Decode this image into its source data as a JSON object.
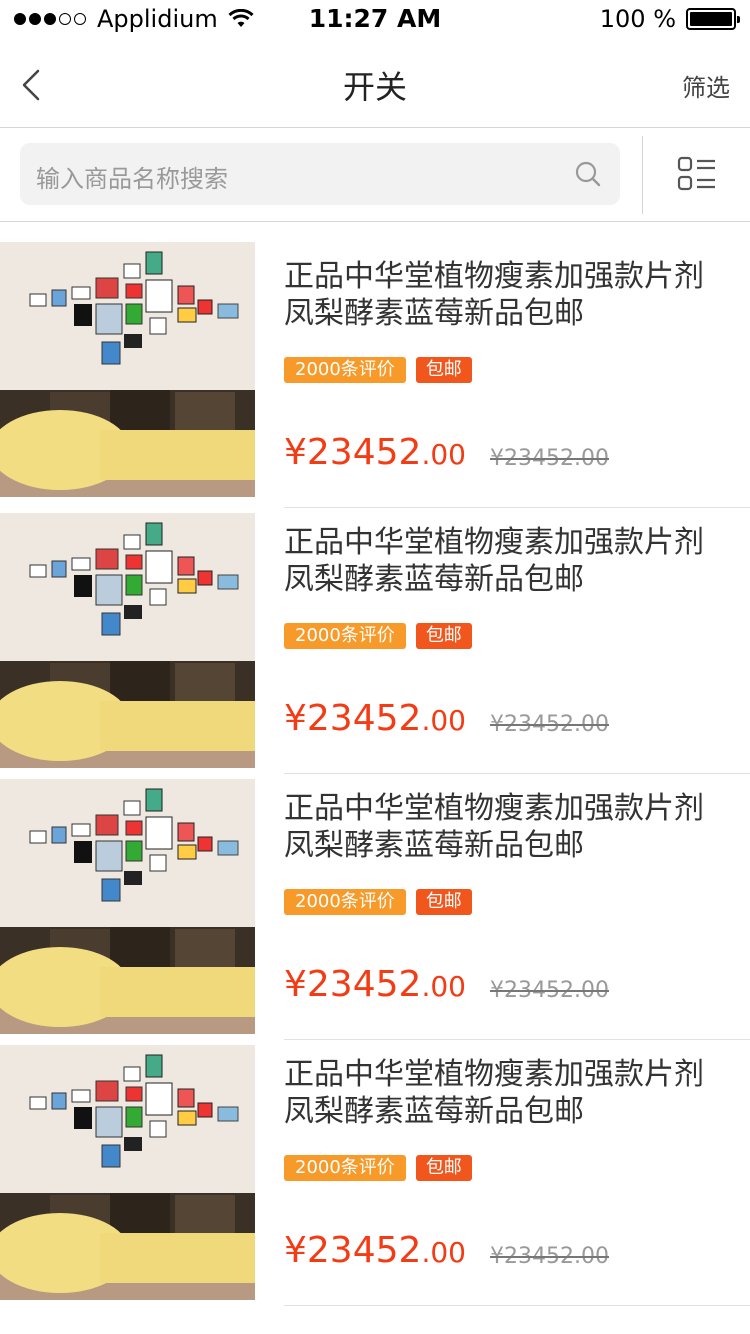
{
  "status_bar": {
    "carrier": "Applidium",
    "time": "11:27 AM",
    "battery": "100 %"
  },
  "nav": {
    "title": "开关",
    "filter": "筛选",
    "back_icon": "chevron-left-icon"
  },
  "search": {
    "placeholder": "输入商品名称搜索",
    "icon": "search-icon",
    "view_toggle_icon": "list-grid-toggle-icon"
  },
  "products": [
    {
      "title": "正品中华堂植物瘦素加强款片剂凤梨酵素蓝莓新品包邮",
      "reviews_tag": "2000条评价",
      "shipping_tag": "包邮",
      "price_main": "¥23452",
      "price_decimals": ".00",
      "old_price": "¥23452.00"
    },
    {
      "title": "正品中华堂植物瘦素加强款片剂凤梨酵素蓝莓新品包邮",
      "reviews_tag": "2000条评价",
      "shipping_tag": "包邮",
      "price_main": "¥23452",
      "price_decimals": ".00",
      "old_price": "¥23452.00"
    },
    {
      "title": "正品中华堂植物瘦素加强款片剂凤梨酵素蓝莓新品包邮",
      "reviews_tag": "2000条评价",
      "shipping_tag": "包邮",
      "price_main": "¥23452",
      "price_decimals": ".00",
      "old_price": "¥23452.00"
    },
    {
      "title": "正品中华堂植物瘦素加强款片剂凤梨酵素蓝莓新品包邮",
      "reviews_tag": "2000条评价",
      "shipping_tag": "包邮",
      "price_main": "¥23452",
      "price_decimals": ".00",
      "old_price": "¥23452.00"
    }
  ],
  "colors": {
    "price": "#f33b14",
    "reviews_tag": "#f79a29",
    "shipping_tag": "#f1561c"
  }
}
